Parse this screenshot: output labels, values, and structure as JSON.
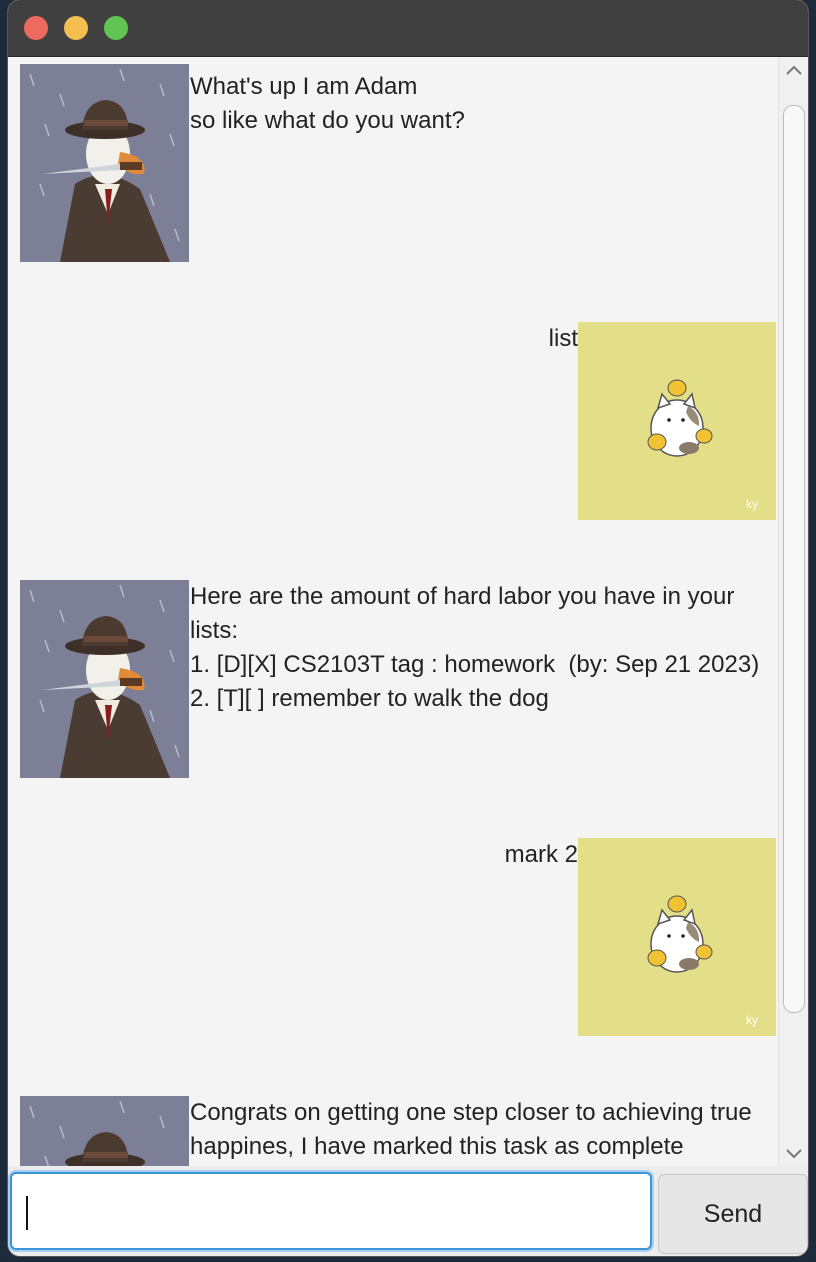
{
  "colors": {
    "titlebar": "#404040",
    "chat_background": "#f4f4f4",
    "input_focus": "#3b95d6",
    "close": "#ed6a5e",
    "minimize": "#f5bf4f",
    "maximize": "#61c554"
  },
  "messages": [
    {
      "sender": "bot",
      "avatar": "duck-detective-avatar",
      "text": "What's up I am Adam\nso like what do you want?"
    },
    {
      "sender": "user",
      "avatar": "cat-with-chicks-avatar",
      "text": "list"
    },
    {
      "sender": "bot",
      "avatar": "duck-detective-avatar",
      "text": "Here are the amount of hard labor you have in your\nlists:\n1. [D][X] CS2103T tag : homework  (by: Sep 21 2023)\n2. [T][ ] remember to walk the dog"
    },
    {
      "sender": "user",
      "avatar": "cat-with-chicks-avatar",
      "text": "mark 2"
    },
    {
      "sender": "bot",
      "avatar": "duck-detective-avatar",
      "text": "Congrats on getting one step closer to achieving true\nhappines, I have marked this task as complete"
    }
  ],
  "input": {
    "value": "",
    "placeholder": ""
  },
  "send_button": {
    "label": "Send"
  },
  "icons": {
    "scroll_up": "chevron-up-icon",
    "scroll_down": "chevron-down-icon"
  }
}
